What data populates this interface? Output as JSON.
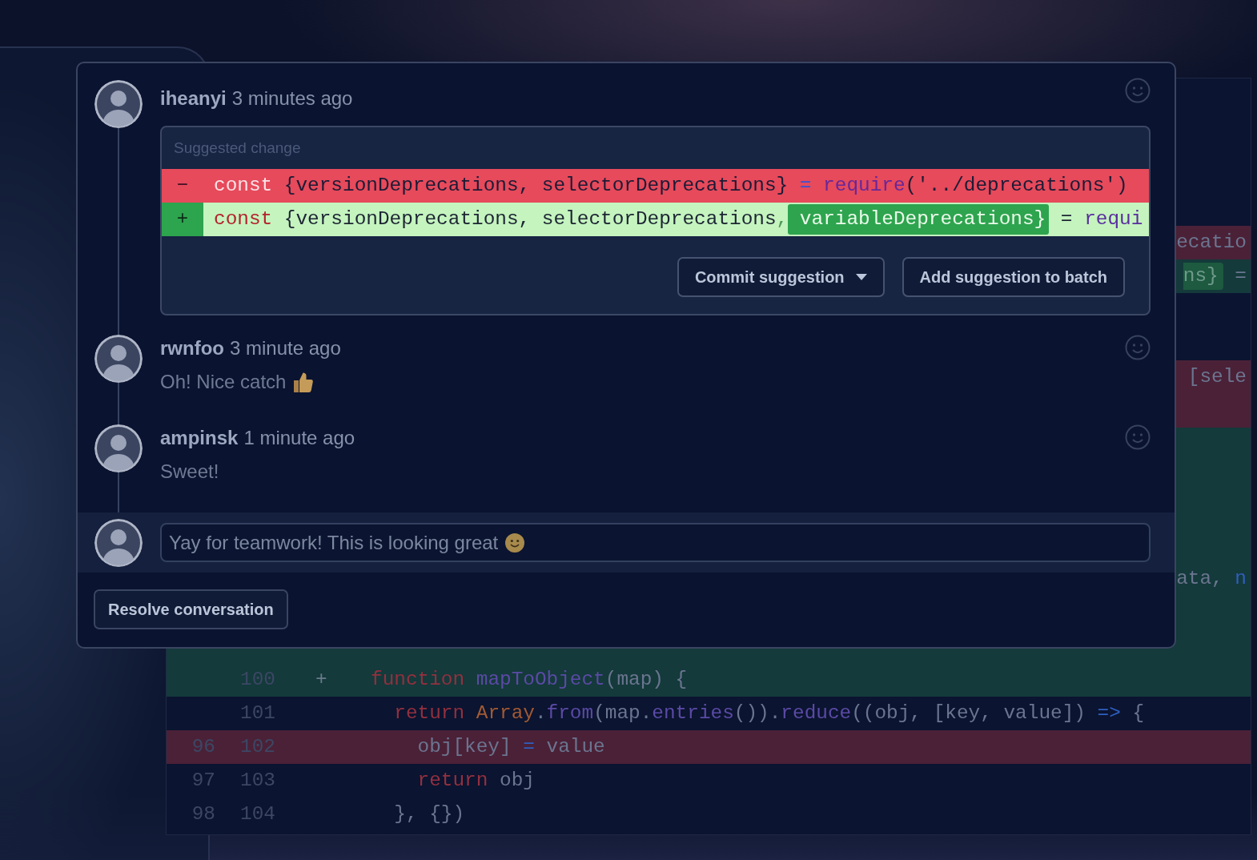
{
  "thread": {
    "comments": [
      {
        "author": "iheanyi",
        "time": "3 minutes ago",
        "suggestion": {
          "title": "Suggested change",
          "lines": [
            {
              "kind": "removed",
              "sign": "−",
              "tokens": [
                {
                  "kind": "keyword",
                  "text": "const"
                },
                {
                  "kind": "plain",
                  "text": " {versionDeprecations, selectorDeprecations} "
                },
                {
                  "kind": "operator",
                  "text": "="
                },
                {
                  "kind": "function",
                  "text": " require"
                },
                {
                  "kind": "plain",
                  "text": "('../deprecations')"
                }
              ]
            },
            {
              "kind": "added",
              "sign": "+",
              "tokens": [
                {
                  "kind": "keyword",
                  "text": "const"
                },
                {
                  "kind": "plain",
                  "text": " {versionDeprecations, selectorDeprecations"
                },
                {
                  "kind": "punctuation",
                  "text": ","
                },
                {
                  "kind": "inserted",
                  "text": " variableDeprecations}"
                },
                {
                  "kind": "plain",
                  "text": " = "
                },
                {
                  "kind": "function",
                  "text": "requi"
                }
              ]
            }
          ],
          "buttons": [
            {
              "label": "Commit suggestion",
              "dropdown": true
            },
            {
              "label": "Add suggestion to batch",
              "dropdown": false
            }
          ]
        }
      },
      {
        "author": "rwnfoo",
        "time": "3 minute ago",
        "body": [
          {
            "kind": "text",
            "text": "Oh! Nice catch"
          },
          {
            "kind": "thumbsup"
          }
        ]
      },
      {
        "author": "ampinsk",
        "time": "1 minute ago",
        "body": [
          {
            "kind": "text",
            "text": "Sweet!"
          }
        ]
      }
    ],
    "reply": {
      "value": [
        {
          "kind": "text",
          "text": "Yay for teamwork! This is looking great"
        },
        {
          "kind": "smile"
        }
      ]
    },
    "resolve_button": "Resolve conversation"
  },
  "background_diff": {
    "edge_rows": [
      {
        "kind": "context"
      },
      {
        "kind": "context"
      },
      {
        "kind": "removed",
        "tokens": [
          {
            "kind": "plain",
            "text": "ecatio"
          }
        ]
      },
      {
        "kind": "added",
        "tokens": [
          {
            "kind": "inserted",
            "text": "ns}"
          },
          {
            "kind": "plain",
            "text": " ="
          }
        ]
      },
      {
        "kind": "context"
      },
      {
        "kind": "context"
      },
      {
        "kind": "removed",
        "tokens": [
          {
            "kind": "plain",
            "text": "[sele"
          }
        ]
      },
      {
        "kind": "removed"
      },
      {
        "kind": "added"
      },
      {
        "kind": "added"
      },
      {
        "kind": "added"
      },
      {
        "kind": "added"
      },
      {
        "kind": "added",
        "tokens": [
          {
            "kind": "plain",
            "text": "ata, "
          },
          {
            "kind": "literal",
            "text": "n"
          }
        ]
      },
      {
        "kind": "added"
      }
    ],
    "rows": [
      {
        "kind": "added"
      },
      {
        "kind": "added",
        "new_number": "100",
        "sign": "+",
        "tokens": [
          {
            "kind": "keyword",
            "text": "function"
          },
          {
            "kind": "function",
            "text": " mapToObject"
          },
          {
            "kind": "plain",
            "text": "(map) {"
          }
        ]
      },
      {
        "kind": "context",
        "new_number": "101",
        "tokens": [
          {
            "kind": "keyword",
            "text": "  return"
          },
          {
            "kind": "type",
            "text": " Array"
          },
          {
            "kind": "plain",
            "text": "."
          },
          {
            "kind": "function",
            "text": "from"
          },
          {
            "kind": "plain",
            "text": "(map."
          },
          {
            "kind": "function",
            "text": "entries"
          },
          {
            "kind": "plain",
            "text": "())."
          },
          {
            "kind": "function",
            "text": "reduce"
          },
          {
            "kind": "plain",
            "text": "((obj, [key, value]) "
          },
          {
            "kind": "operator",
            "text": "=>"
          },
          {
            "kind": "plain",
            "text": " {"
          }
        ]
      },
      {
        "kind": "removed",
        "old_number": "96",
        "new_number": "102",
        "tokens": [
          {
            "kind": "plain",
            "text": "    obj[key] "
          },
          {
            "kind": "operator",
            "text": "="
          },
          {
            "kind": "plain",
            "text": " value"
          }
        ]
      },
      {
        "kind": "context",
        "old_number": "97",
        "new_number": "103",
        "tokens": [
          {
            "kind": "keyword",
            "text": "    return"
          },
          {
            "kind": "plain",
            "text": " obj"
          }
        ]
      },
      {
        "kind": "context",
        "old_number": "98",
        "new_number": "104",
        "tokens": [
          {
            "kind": "plain",
            "text": "  }, {})"
          }
        ]
      }
    ]
  }
}
